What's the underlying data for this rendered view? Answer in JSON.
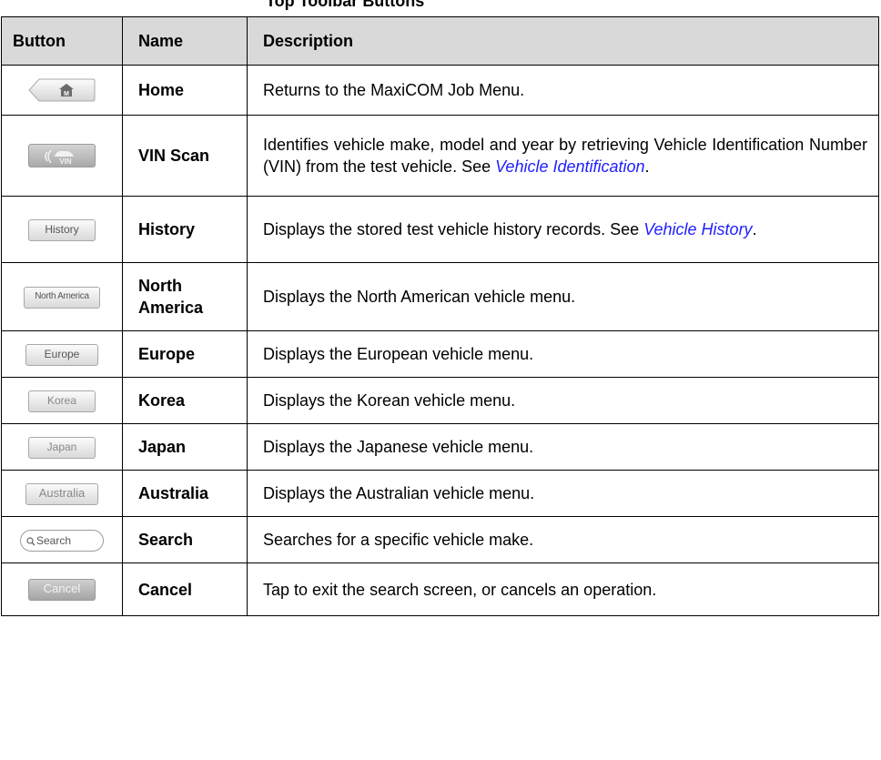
{
  "table_title": "Top Toolbar Buttons",
  "table": {
    "headers": {
      "button": "Button",
      "name": "Name",
      "description": "Description"
    },
    "rows": [
      {
        "button_caption": "M",
        "button_icon": "home-icon",
        "name": "Home",
        "description": "Returns to the MaxiCOM Job Menu."
      },
      {
        "button_caption": "VIN",
        "button_icon": "vin-car-icon",
        "name": "VIN Scan",
        "description": "Identifies vehicle make, model and year by retrieving Vehicle Identification Number (VIN) from the test vehicle. See ",
        "link": "Vehicle Identification",
        "after": "."
      },
      {
        "button_caption": "History",
        "name": "History",
        "description": "Displays the stored test vehicle history records. See ",
        "link": "Vehicle History",
        "after": "."
      },
      {
        "button_caption": "North America",
        "name": "North America",
        "description": "Displays the North American vehicle menu."
      },
      {
        "button_caption": "Europe",
        "name": "Europe",
        "description": "Displays the European vehicle menu."
      },
      {
        "button_caption": "Korea",
        "name": "Korea",
        "description": "Displays the Korean vehicle menu."
      },
      {
        "button_caption": "Japan",
        "name": "Japan",
        "description": "Displays the Japanese vehicle menu."
      },
      {
        "button_caption": "Australia",
        "name": "Australia",
        "description": "Displays the Australian vehicle menu."
      },
      {
        "button_caption": "Search",
        "button_icon": "magnifier-icon",
        "name": "Search",
        "description": "Searches for a specific vehicle make."
      },
      {
        "button_caption": "Cancel",
        "name": "Cancel",
        "description": "Tap to exit the search screen, or cancels an operation."
      }
    ]
  }
}
